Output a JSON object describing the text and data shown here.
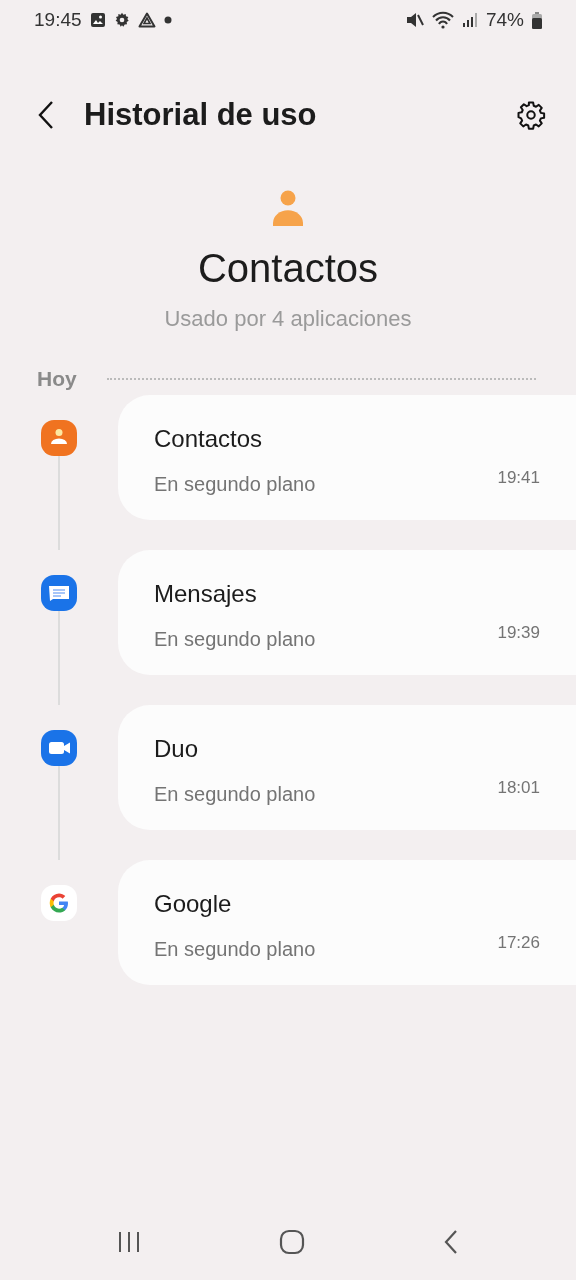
{
  "status_bar": {
    "time": "19:45",
    "battery": "74%"
  },
  "header": {
    "title": "Historial de uso"
  },
  "permission": {
    "name": "Contactos",
    "subtitle": "Usado por 4 aplicaciones"
  },
  "section": {
    "label": "Hoy"
  },
  "apps": [
    {
      "kind": "contacts",
      "name": "Contactos",
      "usage": "En segundo plano",
      "time": "19:41"
    },
    {
      "kind": "messages",
      "name": "Mensajes",
      "usage": "En segundo plano",
      "time": "19:39"
    },
    {
      "kind": "duo",
      "name": "Duo",
      "usage": "En segundo plano",
      "time": "18:01"
    },
    {
      "kind": "google",
      "name": "Google",
      "usage": "En segundo plano",
      "time": "17:26"
    }
  ]
}
